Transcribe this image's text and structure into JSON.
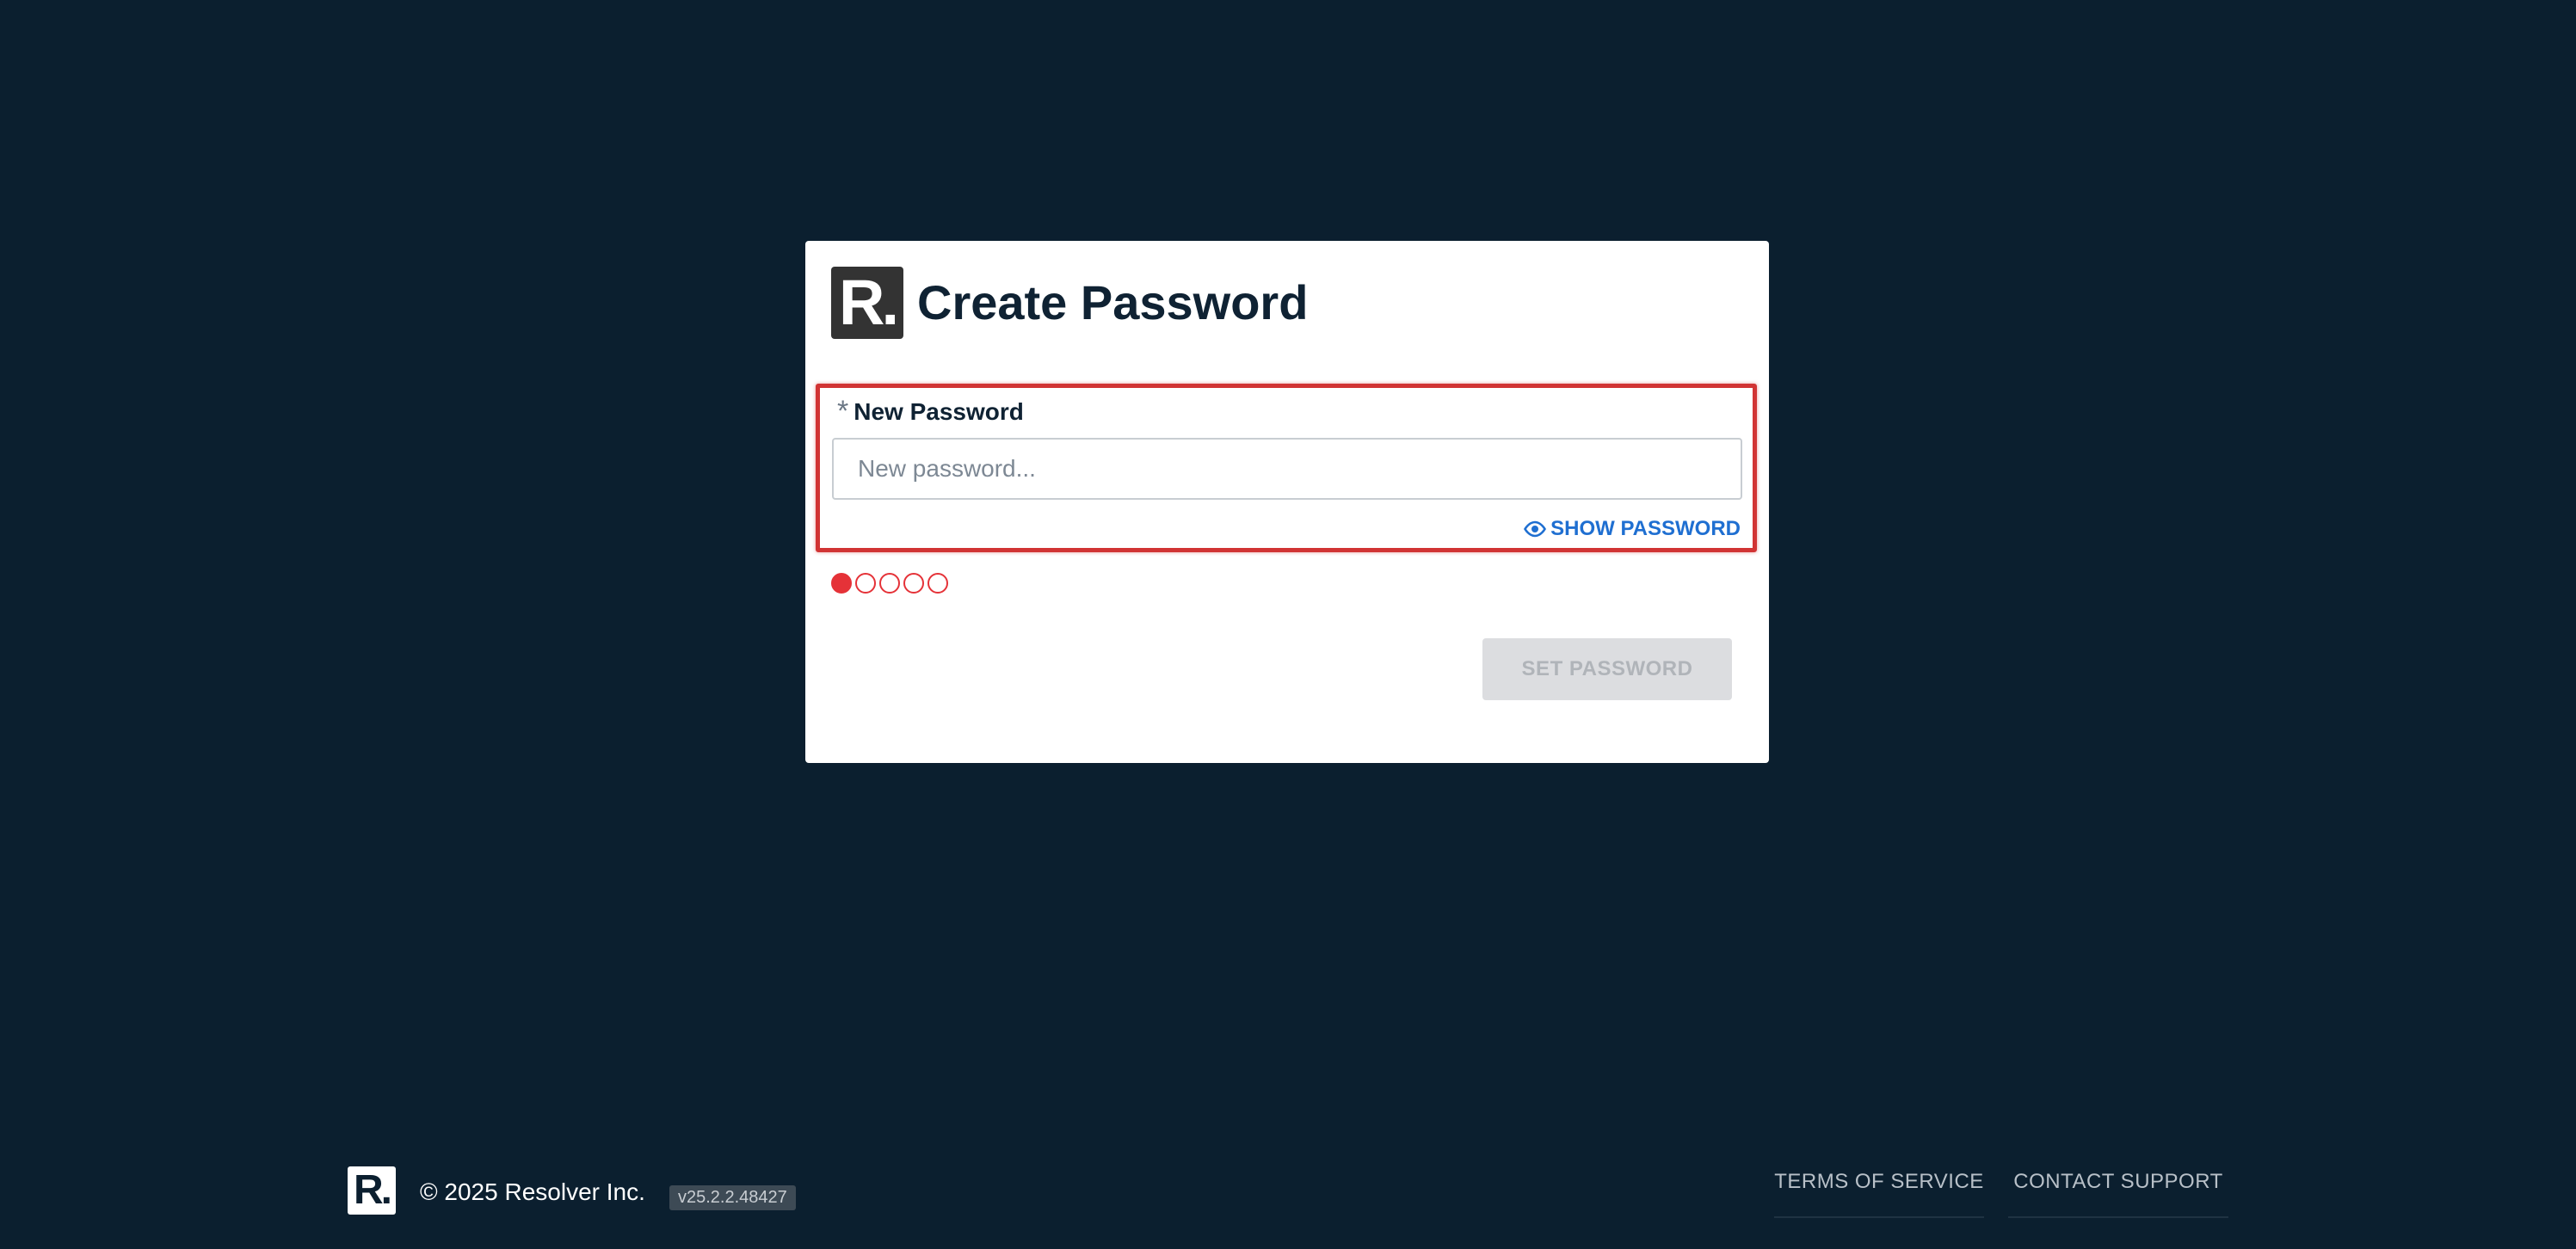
{
  "card": {
    "logo_text": "R.",
    "title": "Create Password"
  },
  "form": {
    "required_marker": "*",
    "label": "New Password",
    "input_value": "",
    "input_placeholder": "New password...",
    "show_password_label": "SHOW PASSWORD",
    "strength": {
      "filled": 1,
      "total": 5,
      "color": "#e53238"
    },
    "submit_label": "SET PASSWORD",
    "submit_enabled": false
  },
  "footer": {
    "logo_text": "R.",
    "copyright": "© 2025 Resolver Inc.",
    "version": "v25.2.2.48427",
    "links": [
      "TERMS OF SERVICE",
      "CONTACT SUPPORT"
    ]
  },
  "colors": {
    "background": "#0b1f2f",
    "accent": "#1f6fd1",
    "highlight_border": "#d13434"
  }
}
